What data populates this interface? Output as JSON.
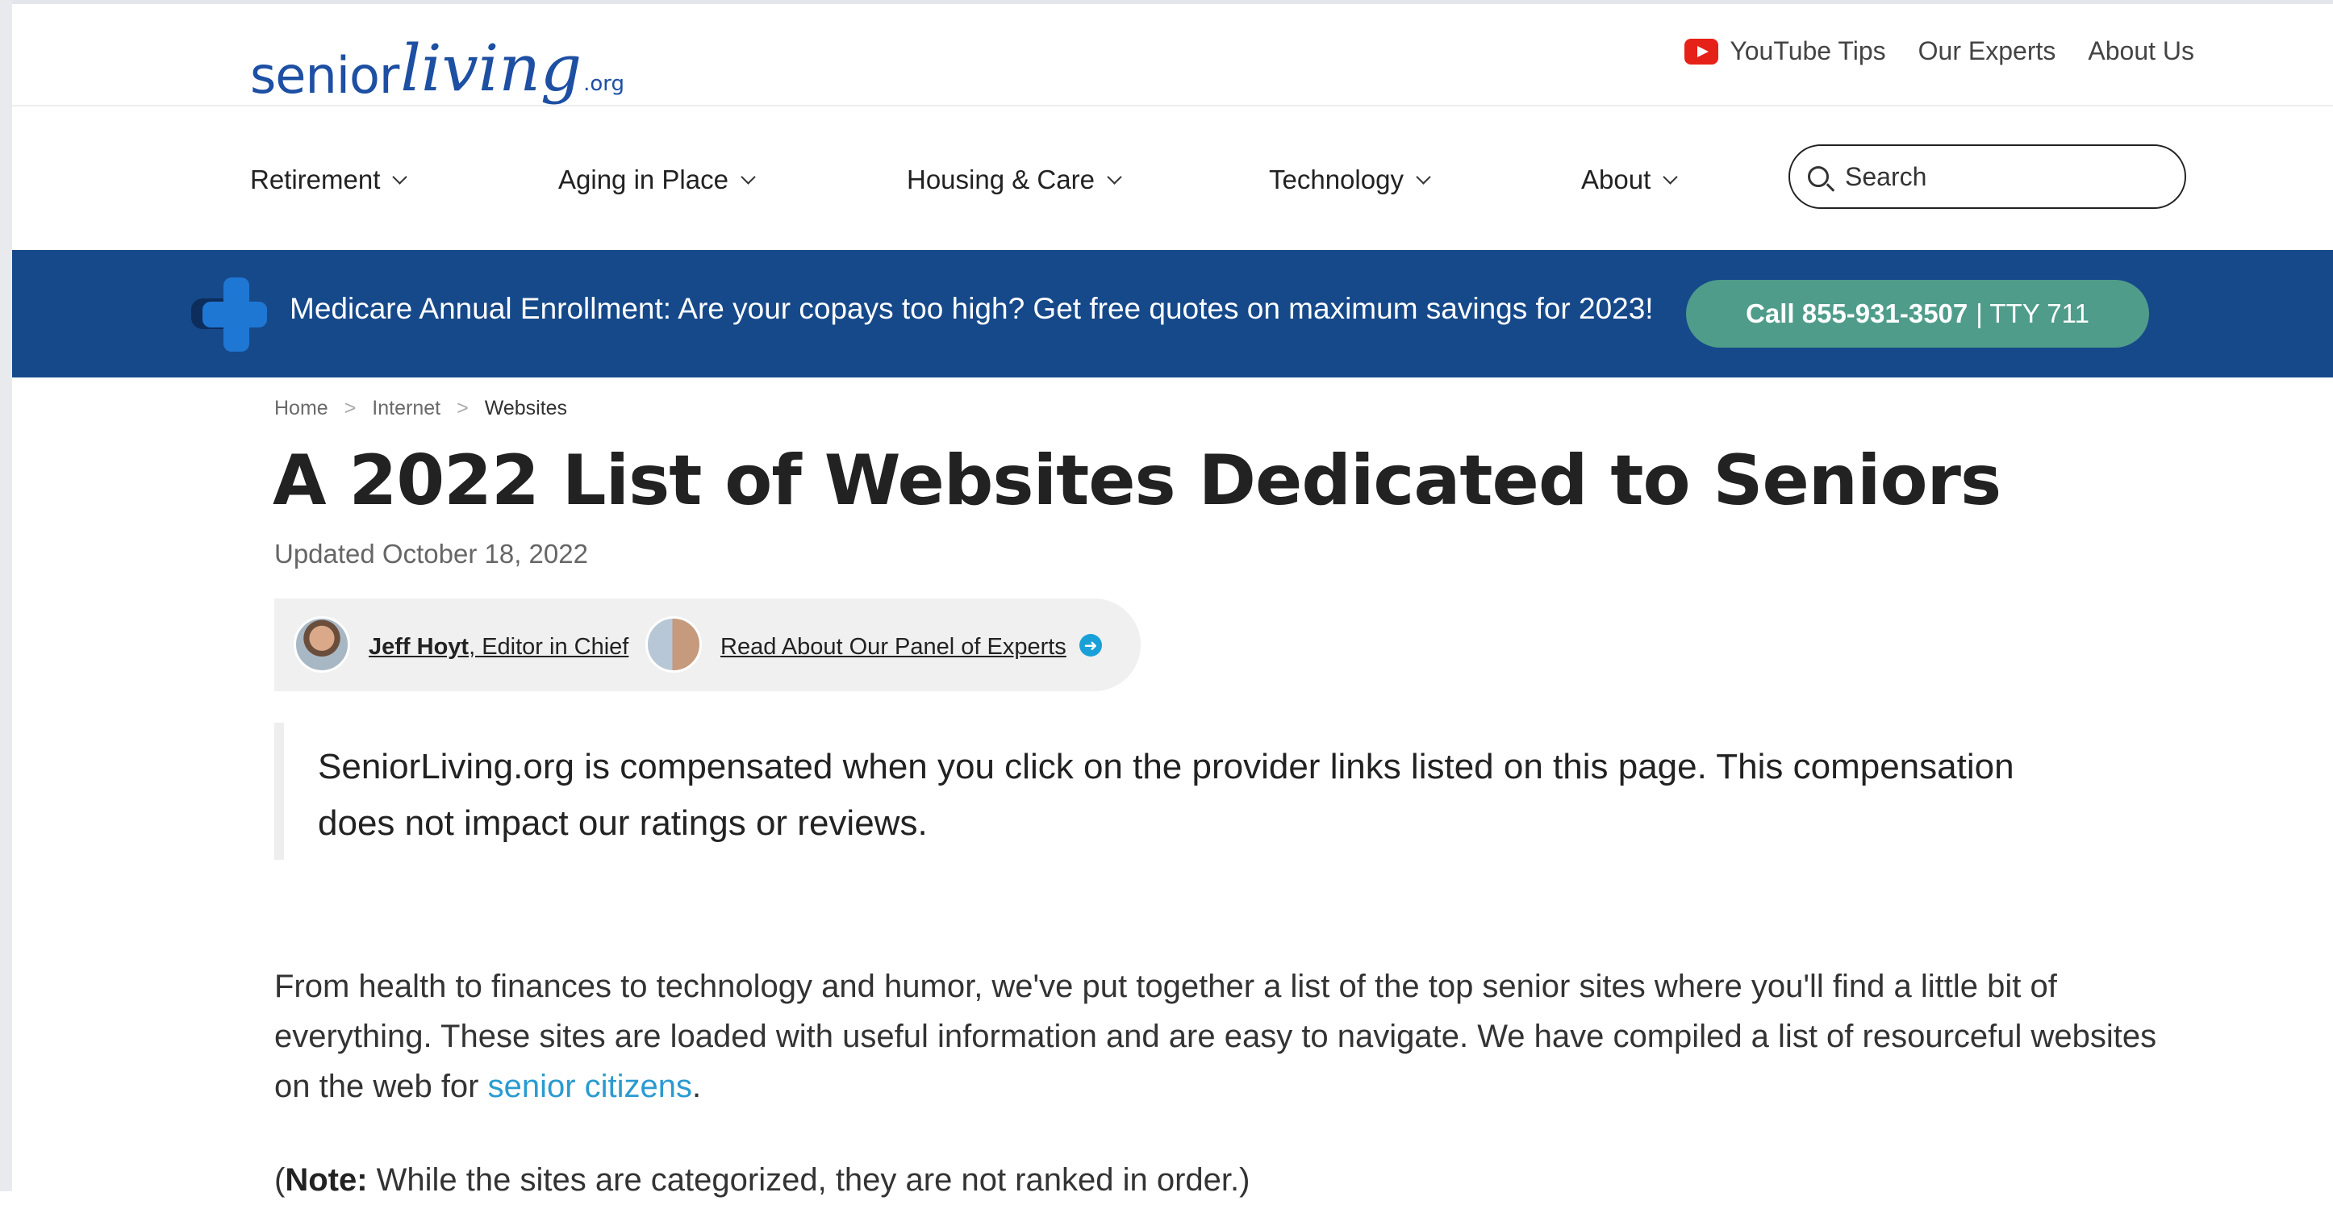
{
  "header": {
    "logo": {
      "part1": "senior",
      "part2": "living",
      "suffix": ".org"
    },
    "links": [
      {
        "label": "YouTube Tips",
        "icon": "youtube-icon"
      },
      {
        "label": "Our Experts"
      },
      {
        "label": "About Us"
      }
    ]
  },
  "nav": {
    "items": [
      {
        "label": "Retirement"
      },
      {
        "label": "Aging in Place"
      },
      {
        "label": "Housing & Care"
      },
      {
        "label": "Technology"
      },
      {
        "label": "About"
      }
    ],
    "search_placeholder": "Search"
  },
  "banner": {
    "text": "Medicare Annual Enrollment: Are your copays too high? Get free quotes on maximum savings for 2023!",
    "call_label": "Call 855-931-3507",
    "tty": "| TTY 711",
    "colors": {
      "background": "#16498a",
      "button": "#4f9c8a"
    }
  },
  "breadcrumb": {
    "items": [
      "Home",
      "Internet",
      "Websites"
    ],
    "separator": ">"
  },
  "article": {
    "title": "A 2022 List of Websites Dedicated to Seniors",
    "updated": "Updated October 18, 2022",
    "author": {
      "name": "Jeff Hoyt",
      "role": ", Editor in Chief"
    },
    "panel_link": "Read About Our Panel of Experts",
    "disclosure": "SeniorLiving.org is compensated when you click on the provider links listed on this page. This compensation does not impact our ratings or reviews.",
    "intro": "From health to finances to technology and humor, we've put together a list of the top senior sites where you'll find a little bit of everything. These sites are loaded with useful information and are easy to navigate. We have compiled a list of resourceful websites on the web for ",
    "intro_link": "senior citizens",
    "intro_end": ".",
    "note_open": "(",
    "note_label": "Note:",
    "note_text": " While the sites are categorized, they are not ranked in order.)"
  }
}
